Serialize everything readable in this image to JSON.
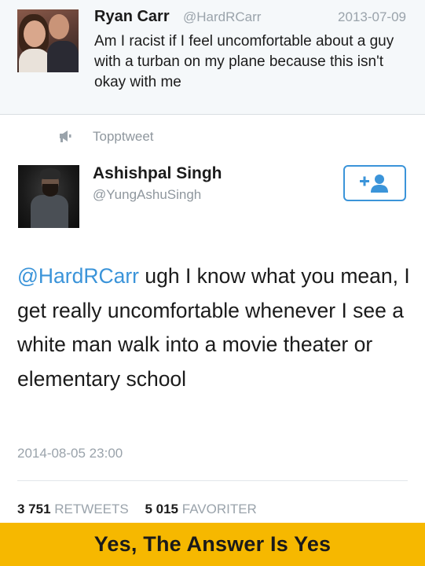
{
  "original_tweet": {
    "name": "Ryan Carr",
    "handle": "@HardRCarr",
    "date": "2013-07-09",
    "text": "Am I racist if I feel uncomfortable about a guy with a turban on my plane because this isn't okay with me",
    "avatar_icon": "profile-photo-couple"
  },
  "retweet": {
    "label": "Topptweet",
    "icon": "megaphone-icon"
  },
  "reply": {
    "name": "Ashishpal Singh",
    "handle": "@YungAshuSingh",
    "mention": "@HardRCarr",
    "text": " ugh I know what you mean, I get really uncomfortable whenever I see a white man walk into a movie theater or elementary school",
    "date": "2014-08-05 23:00",
    "follow_icon": "add-user-icon",
    "stats": {
      "retweets_count": "3 751",
      "retweets_label": "RETWEETS",
      "favorites_count": "5 015",
      "favorites_label": "FAVORITER"
    }
  },
  "caption": "Yes, The Answer Is Yes",
  "colors": {
    "link_blue": "#3b94d9",
    "muted_gray": "#9aa3ab",
    "caption_yellow": "#f6b800",
    "quoted_bg": "#f5f8fa"
  }
}
